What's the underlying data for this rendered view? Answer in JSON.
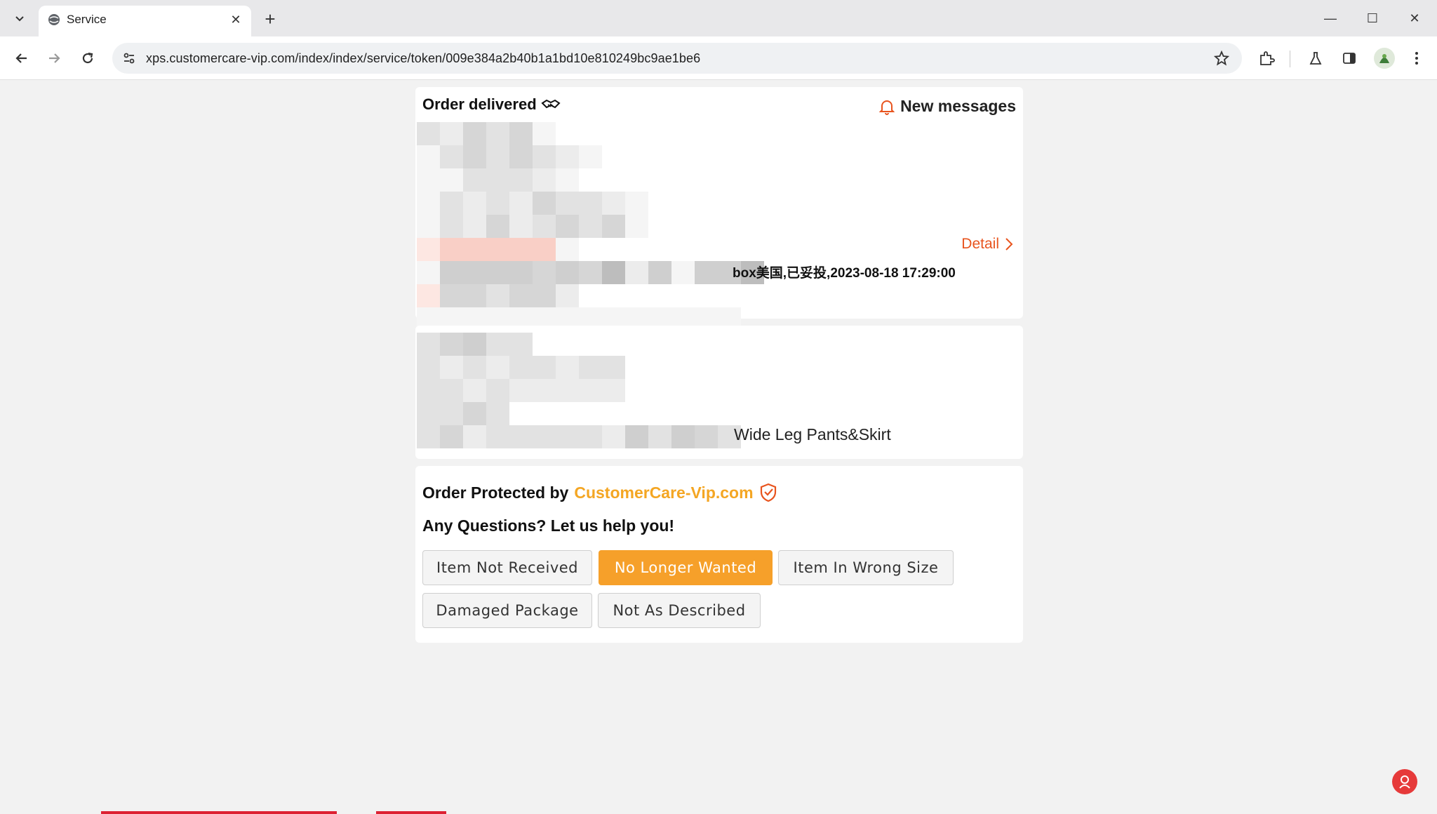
{
  "browser": {
    "tab_title": "Service",
    "url": "xps.customercare-vip.com/index/index/service/token/009e384a2b40b1a1bd10e810249bc9ae1be6"
  },
  "order": {
    "status": "Order delivered",
    "new_messages": "New messages",
    "detail_link": "Detail",
    "tracking_text": "box美国,已妥投,2023-08-18 17:29:00"
  },
  "product": {
    "name": "Wide Leg Pants&Skirt"
  },
  "support": {
    "protected_prefix": "Order Protected by",
    "brand": "CustomerCare-Vip.com",
    "question": "Any Questions? Let us help you!",
    "options": [
      {
        "label": "Item Not Received",
        "selected": false
      },
      {
        "label": "No Longer Wanted",
        "selected": true
      },
      {
        "label": "Item In Wrong Size",
        "selected": false
      },
      {
        "label": "Damaged Package",
        "selected": false
      },
      {
        "label": "Not As Described",
        "selected": false
      }
    ]
  },
  "colors": {
    "accent_orange": "#f6a02a",
    "brand_orange": "#f4a623",
    "link_orange": "#e8541e"
  }
}
